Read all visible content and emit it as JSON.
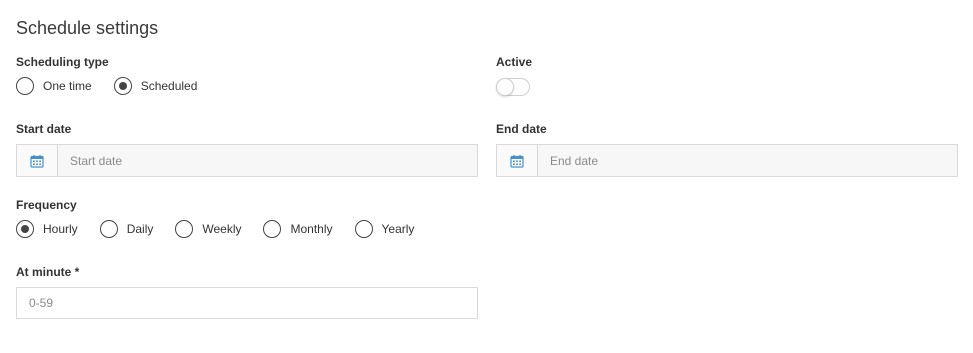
{
  "title": "Schedule settings",
  "scheduling_type": {
    "label": "Scheduling type",
    "options": [
      {
        "label": "One time",
        "selected": false
      },
      {
        "label": "Scheduled",
        "selected": true
      }
    ]
  },
  "active": {
    "label": "Active",
    "on": false
  },
  "start_date": {
    "label": "Start date",
    "placeholder": "Start date",
    "icon": "calendar-icon"
  },
  "end_date": {
    "label": "End date",
    "placeholder": "End date",
    "icon": "calendar-icon"
  },
  "frequency": {
    "label": "Frequency",
    "options": [
      {
        "label": "Hourly",
        "selected": true
      },
      {
        "label": "Daily",
        "selected": false
      },
      {
        "label": "Weekly",
        "selected": false
      },
      {
        "label": "Monthly",
        "selected": false
      },
      {
        "label": "Yearly",
        "selected": false
      }
    ]
  },
  "at_minute": {
    "label": "At minute *",
    "placeholder": "0-59"
  },
  "colors": {
    "calendar_icon": "#4a90c8",
    "radio_border": "#444444"
  }
}
